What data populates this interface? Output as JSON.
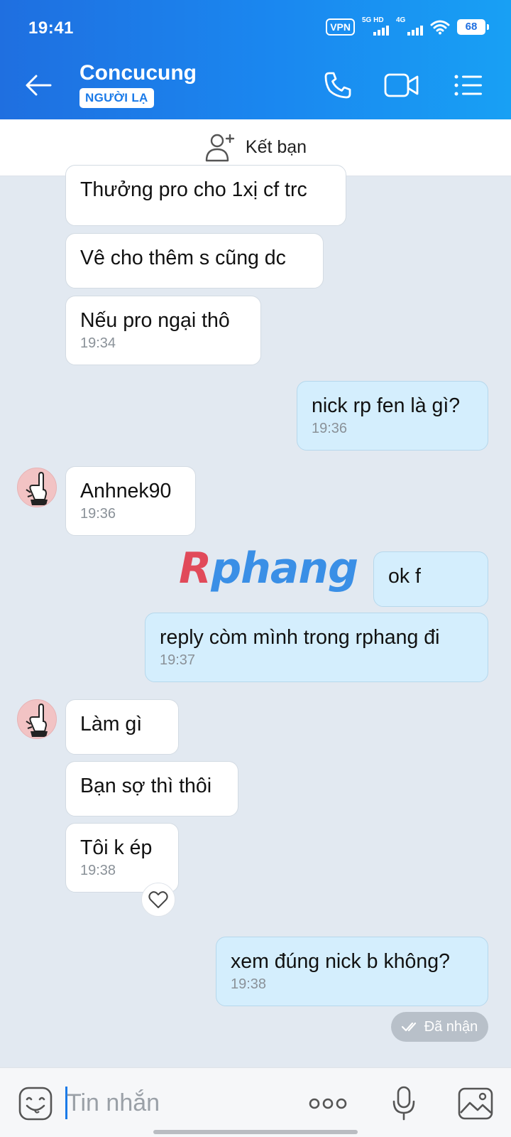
{
  "status_bar": {
    "time": "19:41",
    "vpn": "VPN",
    "network_1": "5G HD",
    "network_2": "4G",
    "battery": "68"
  },
  "header": {
    "contact_name": "Concucung",
    "stranger_badge": "NGƯỜI LẠ",
    "icons": [
      "back-arrow-icon",
      "phone-icon",
      "video-call-icon",
      "menu-list-icon"
    ]
  },
  "add_friend": {
    "label": "Kết bạn",
    "icon": "add-person-icon"
  },
  "messages": [
    {
      "side": "in",
      "text": "Thưởng pro cho 1xị cf trc",
      "time": ""
    },
    {
      "side": "in",
      "text": "Vê cho thêm s cũng dc",
      "time": ""
    },
    {
      "side": "in",
      "text": "Nếu pro ngại thô",
      "time": "19:34"
    },
    {
      "side": "out",
      "text": "nick rp fen là gì?",
      "time": "19:36"
    },
    {
      "side": "in",
      "text": "Anhnek90",
      "time": "19:36"
    },
    {
      "side": "out",
      "text": "ok f",
      "time": ""
    },
    {
      "side": "out",
      "text": "reply còm mình trong rphang đi",
      "time": "19:37"
    },
    {
      "side": "in",
      "text": "Làm gì",
      "time": ""
    },
    {
      "side": "in",
      "text": "Bạn sợ thì thôi",
      "time": ""
    },
    {
      "side": "in",
      "text": "Tôi k ép",
      "time": "19:38"
    },
    {
      "side": "out",
      "text": "xem đúng nick b không?",
      "time": "19:38"
    }
  ],
  "watermark": {
    "r": "R",
    "rest": "phang"
  },
  "delivery_status": "Đã nhận",
  "input_bar": {
    "placeholder": "Tin nhắn",
    "icons": [
      "sticker-icon",
      "more-dots-icon",
      "microphone-icon",
      "image-icon"
    ]
  },
  "colors": {
    "header_start": "#1f6fe0",
    "header_end": "#18a0f4",
    "chat_background": "#e2e9f1",
    "outgoing_bubble": "#d4eefd",
    "incoming_bubble": "#ffffff"
  }
}
